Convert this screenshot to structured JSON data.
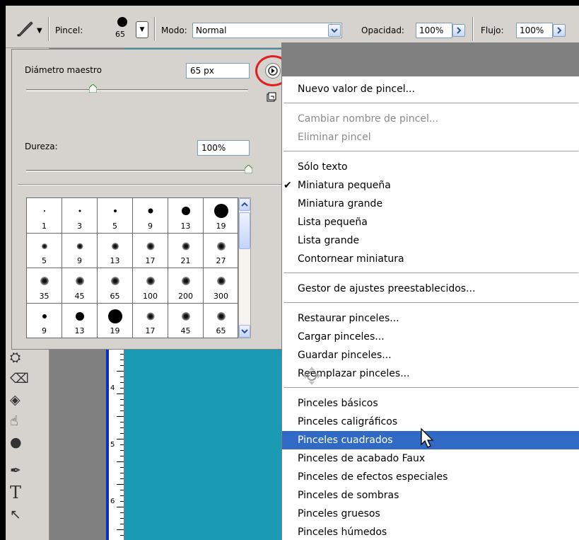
{
  "options_bar": {
    "brush_label": "Pincel:",
    "brush_size": "65",
    "mode_label": "Modo:",
    "mode_value": "Normal",
    "opacity_label": "Opacidad:",
    "opacity_value": "100%",
    "flow_label": "Flujo:",
    "flow_value": "100%"
  },
  "brush_panel": {
    "master_diameter_label": "Diámetro maestro",
    "master_diameter_value": "65 px",
    "master_diameter_fraction": 0.3,
    "hardness_label": "Dureza:",
    "hardness_value": "100%",
    "hardness_fraction": 1.0,
    "presets": [
      {
        "label": "1",
        "kind": "hard",
        "size": 2
      },
      {
        "label": "3",
        "kind": "hard",
        "size": 3
      },
      {
        "label": "5",
        "kind": "hard",
        "size": 4
      },
      {
        "label": "9",
        "kind": "hard",
        "size": 7
      },
      {
        "label": "13",
        "kind": "hard",
        "size": 12
      },
      {
        "label": "19",
        "kind": "hard",
        "size": 20
      },
      {
        "label": "5",
        "kind": "soft",
        "size": 4
      },
      {
        "label": "9",
        "kind": "soft",
        "size": 5
      },
      {
        "label": "13",
        "kind": "soft",
        "size": 6
      },
      {
        "label": "17",
        "kind": "soft",
        "size": 7
      },
      {
        "label": "21",
        "kind": "soft",
        "size": 7
      },
      {
        "label": "27",
        "kind": "soft",
        "size": 8
      },
      {
        "label": "35",
        "kind": "soft",
        "size": 8
      },
      {
        "label": "45",
        "kind": "soft",
        "size": 8
      },
      {
        "label": "65",
        "kind": "soft",
        "size": 8
      },
      {
        "label": "100",
        "kind": "soft",
        "size": 8
      },
      {
        "label": "200",
        "kind": "soft",
        "size": 8
      },
      {
        "label": "300",
        "kind": "soft",
        "size": 8
      },
      {
        "label": "9",
        "kind": "hard",
        "size": 6
      },
      {
        "label": "13",
        "kind": "hard",
        "size": 12
      },
      {
        "label": "19",
        "kind": "hard",
        "size": 20
      },
      {
        "label": "17",
        "kind": "soft",
        "size": 7
      },
      {
        "label": "45",
        "kind": "soft",
        "size": 8
      },
      {
        "label": "65",
        "kind": "soft",
        "size": 8
      }
    ]
  },
  "ruler": {
    "labels": [
      "4",
      "5",
      "6"
    ]
  },
  "menu": {
    "items": [
      {
        "label": "Nuevo valor de pincel...",
        "state": "normal"
      },
      {
        "label": "Cambiar nombre de pincel...",
        "state": "disabled"
      },
      {
        "label": "Eliminar pincel",
        "state": "disabled"
      },
      {
        "label": "Sólo texto",
        "state": "normal"
      },
      {
        "label": "Miniatura pequeña",
        "state": "checked"
      },
      {
        "label": "Miniatura grande",
        "state": "normal"
      },
      {
        "label": "Lista pequeña",
        "state": "normal"
      },
      {
        "label": "Lista grande",
        "state": "normal"
      },
      {
        "label": "Contornear miniatura",
        "state": "normal"
      },
      {
        "label": "Gestor de ajustes preestablecidos...",
        "state": "normal"
      },
      {
        "label": "Restaurar pinceles...",
        "state": "normal"
      },
      {
        "label": "Cargar pinceles...",
        "state": "normal"
      },
      {
        "label": "Guardar pinceles...",
        "state": "normal"
      },
      {
        "label": "Reemplazar pinceles...",
        "state": "normal"
      },
      {
        "label": "Pinceles básicos",
        "state": "normal"
      },
      {
        "label": "Pinceles caligráficos",
        "state": "normal"
      },
      {
        "label": "Pinceles cuadrados",
        "state": "selected"
      },
      {
        "label": "Pinceles de acabado Faux",
        "state": "normal"
      },
      {
        "label": "Pinceles de efectos especiales",
        "state": "normal"
      },
      {
        "label": "Pinceles de sombras",
        "state": "normal"
      },
      {
        "label": "Pinceles gruesos",
        "state": "normal"
      },
      {
        "label": "Pinceles húmedos",
        "state": "normal"
      }
    ],
    "check_glyph": "✔",
    "selected_color": "#316ac5"
  },
  "colors": {
    "canvas": "#1a9ab3",
    "highlight_circle": "#e02020",
    "selection": "#316ac5"
  }
}
